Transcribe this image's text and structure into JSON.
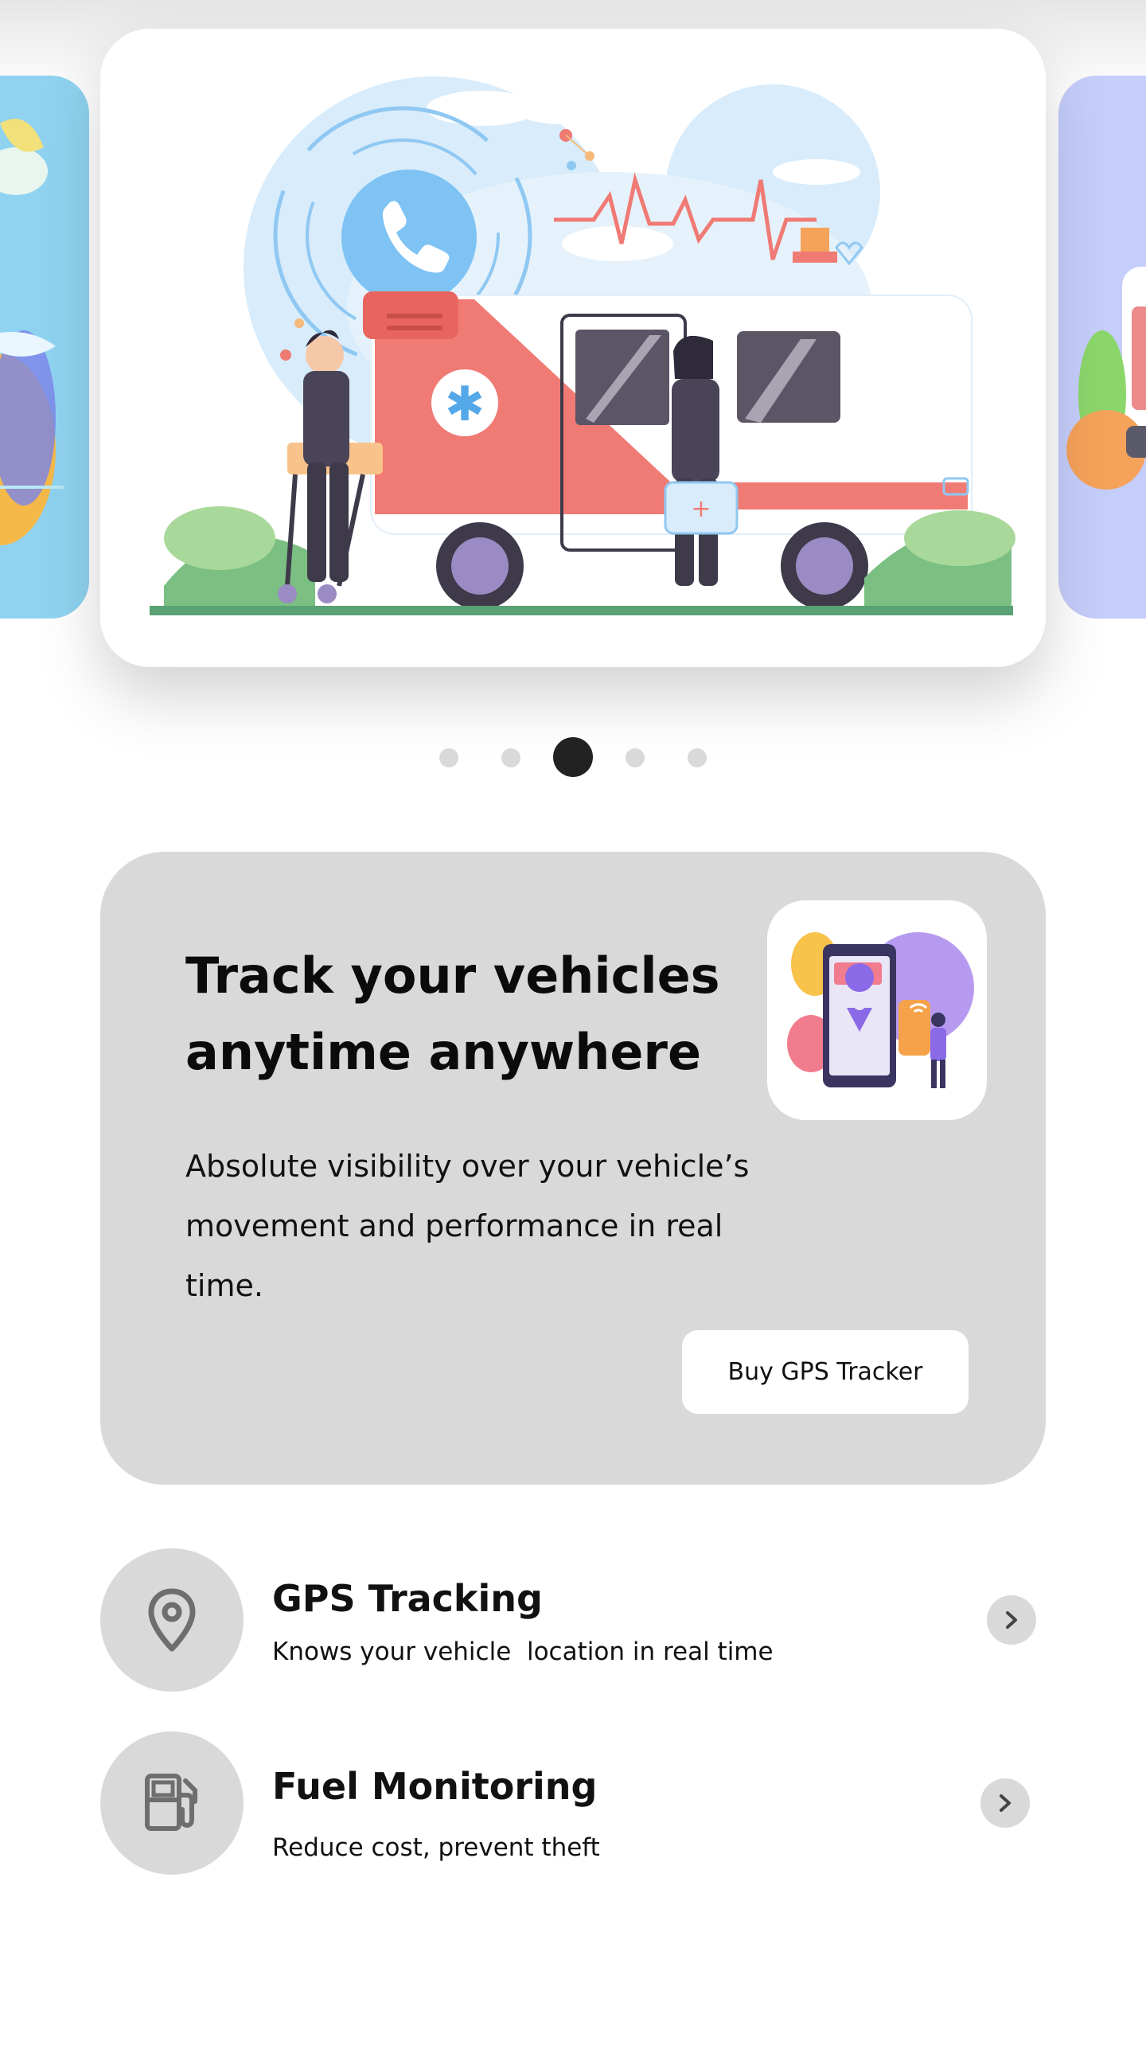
{
  "carousel": {
    "slide_count": 5,
    "active_index": 2,
    "main_slide_icon": "ambulance-illustration",
    "left_slide_icon": "plant-illustration",
    "right_slide_icon": "vehicle-illustration"
  },
  "promo": {
    "title_line1": "Track your vehicles",
    "title_line2": "anytime anywhere",
    "desc_line1": "Absolute visibility over your vehicle’s",
    "desc_line2": "movement and performance in real",
    "desc_line3": "time.",
    "button_label": "Buy GPS Tracker",
    "thumbnail_icon": "gps-phone-illustration",
    "background": "#d9d9d9"
  },
  "features": [
    {
      "title": "GPS Tracking",
      "subtitle": "Knows your vehicle  location in real time",
      "icon": "location-pin-icon"
    },
    {
      "title": "Fuel Monitoring",
      "subtitle": "Reduce cost, prevent theft",
      "icon": "fuel-pump-icon"
    }
  ],
  "colors": {
    "accent_dark": "#222222",
    "card_gray": "#d9d9d9",
    "ambulance_red": "#f07a74",
    "sky_blue": "#cfe7f8"
  }
}
